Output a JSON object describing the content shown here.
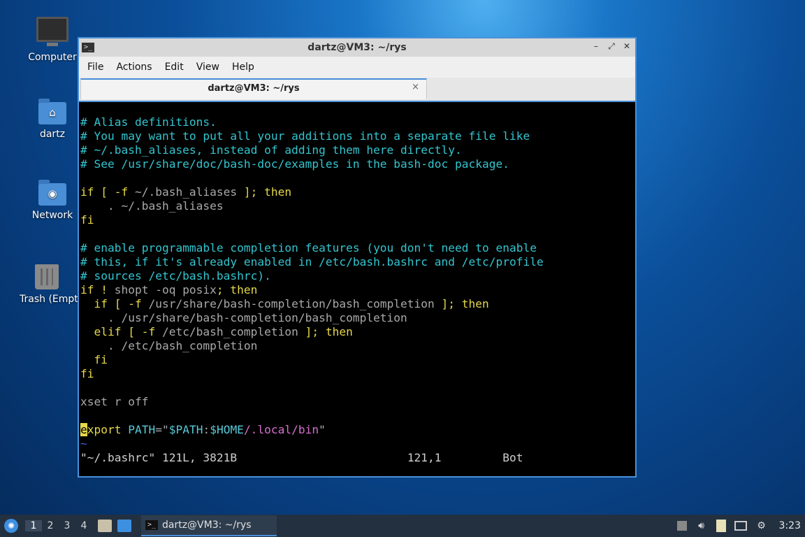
{
  "desktop": {
    "icons": [
      {
        "label": "Computer",
        "icon": "computer-icon"
      },
      {
        "label": "dartz",
        "icon": "home-folder-icon"
      },
      {
        "label": "Network",
        "icon": "network-folder-icon"
      },
      {
        "label": "Trash (Empt",
        "icon": "trash-icon"
      }
    ]
  },
  "window": {
    "title": "dartz@VM3: ~/rys",
    "menu": [
      "File",
      "Actions",
      "Edit",
      "View",
      "Help"
    ],
    "tab_title": "dartz@VM3: ~/rys",
    "tab_close": "×",
    "controls": {
      "minimize": "–",
      "maximize": "⤢",
      "close": "✕"
    }
  },
  "terminal": {
    "lines": {
      "l1": "# Alias definitions.",
      "l2": "# You may want to put all your additions into a separate file like",
      "l3": "# ~/.bash_aliases, instead of adding them here directly.",
      "l4": "# See /usr/share/doc/bash-doc/examples in the bash-doc package.",
      "l6a": "if [ -f ",
      "l6b": "~/.bash_aliases",
      "l6c": " ]; then",
      "l7": "    . ~/.bash_aliases",
      "l8": "fi",
      "l10": "# enable programmable completion features (you don't need to enable",
      "l11": "# this, if it's already enabled in /etc/bash.bashrc and /etc/profile",
      "l12": "# sources /etc/bash.bashrc).",
      "l13a": "if ! ",
      "l13b": "shopt -oq posix",
      "l13c": "; then",
      "l14a": "  if [ -f ",
      "l14b": "/usr/share/bash-completion/bash_completion",
      "l14c": " ]; then",
      "l15": "    . /usr/share/bash-completion/bash_completion",
      "l16a": "  elif [ -f ",
      "l16b": "/etc/bash_completion",
      "l16c": " ]; then",
      "l17": "    . /etc/bash_completion",
      "l18": "  fi",
      "l19": "fi",
      "l21": "xset r off",
      "l23_cursor": "e",
      "l23a": "xport ",
      "l23b": "PATH",
      "l23c": "=\"",
      "l23d": "$PATH",
      "l23e": ":",
      "l23f": "$HOME",
      "l23g": "/.local/bin",
      "l23h": "\"",
      "tilde": "~"
    },
    "status": {
      "file": "\"~/.bashrc\" 121L, 3821B",
      "position": "121,1",
      "scroll": "Bot"
    }
  },
  "taskbar": {
    "workspaces": [
      "1",
      "2",
      "3",
      "4"
    ],
    "active_workspace": "1",
    "task_label": "dartz@VM3: ~/rys",
    "clock": "3:23"
  },
  "colors": {
    "accent": "#4a90d9",
    "comment": "#33c5cf",
    "keyword": "#e6d84a",
    "string_path": "#d76fd0"
  }
}
